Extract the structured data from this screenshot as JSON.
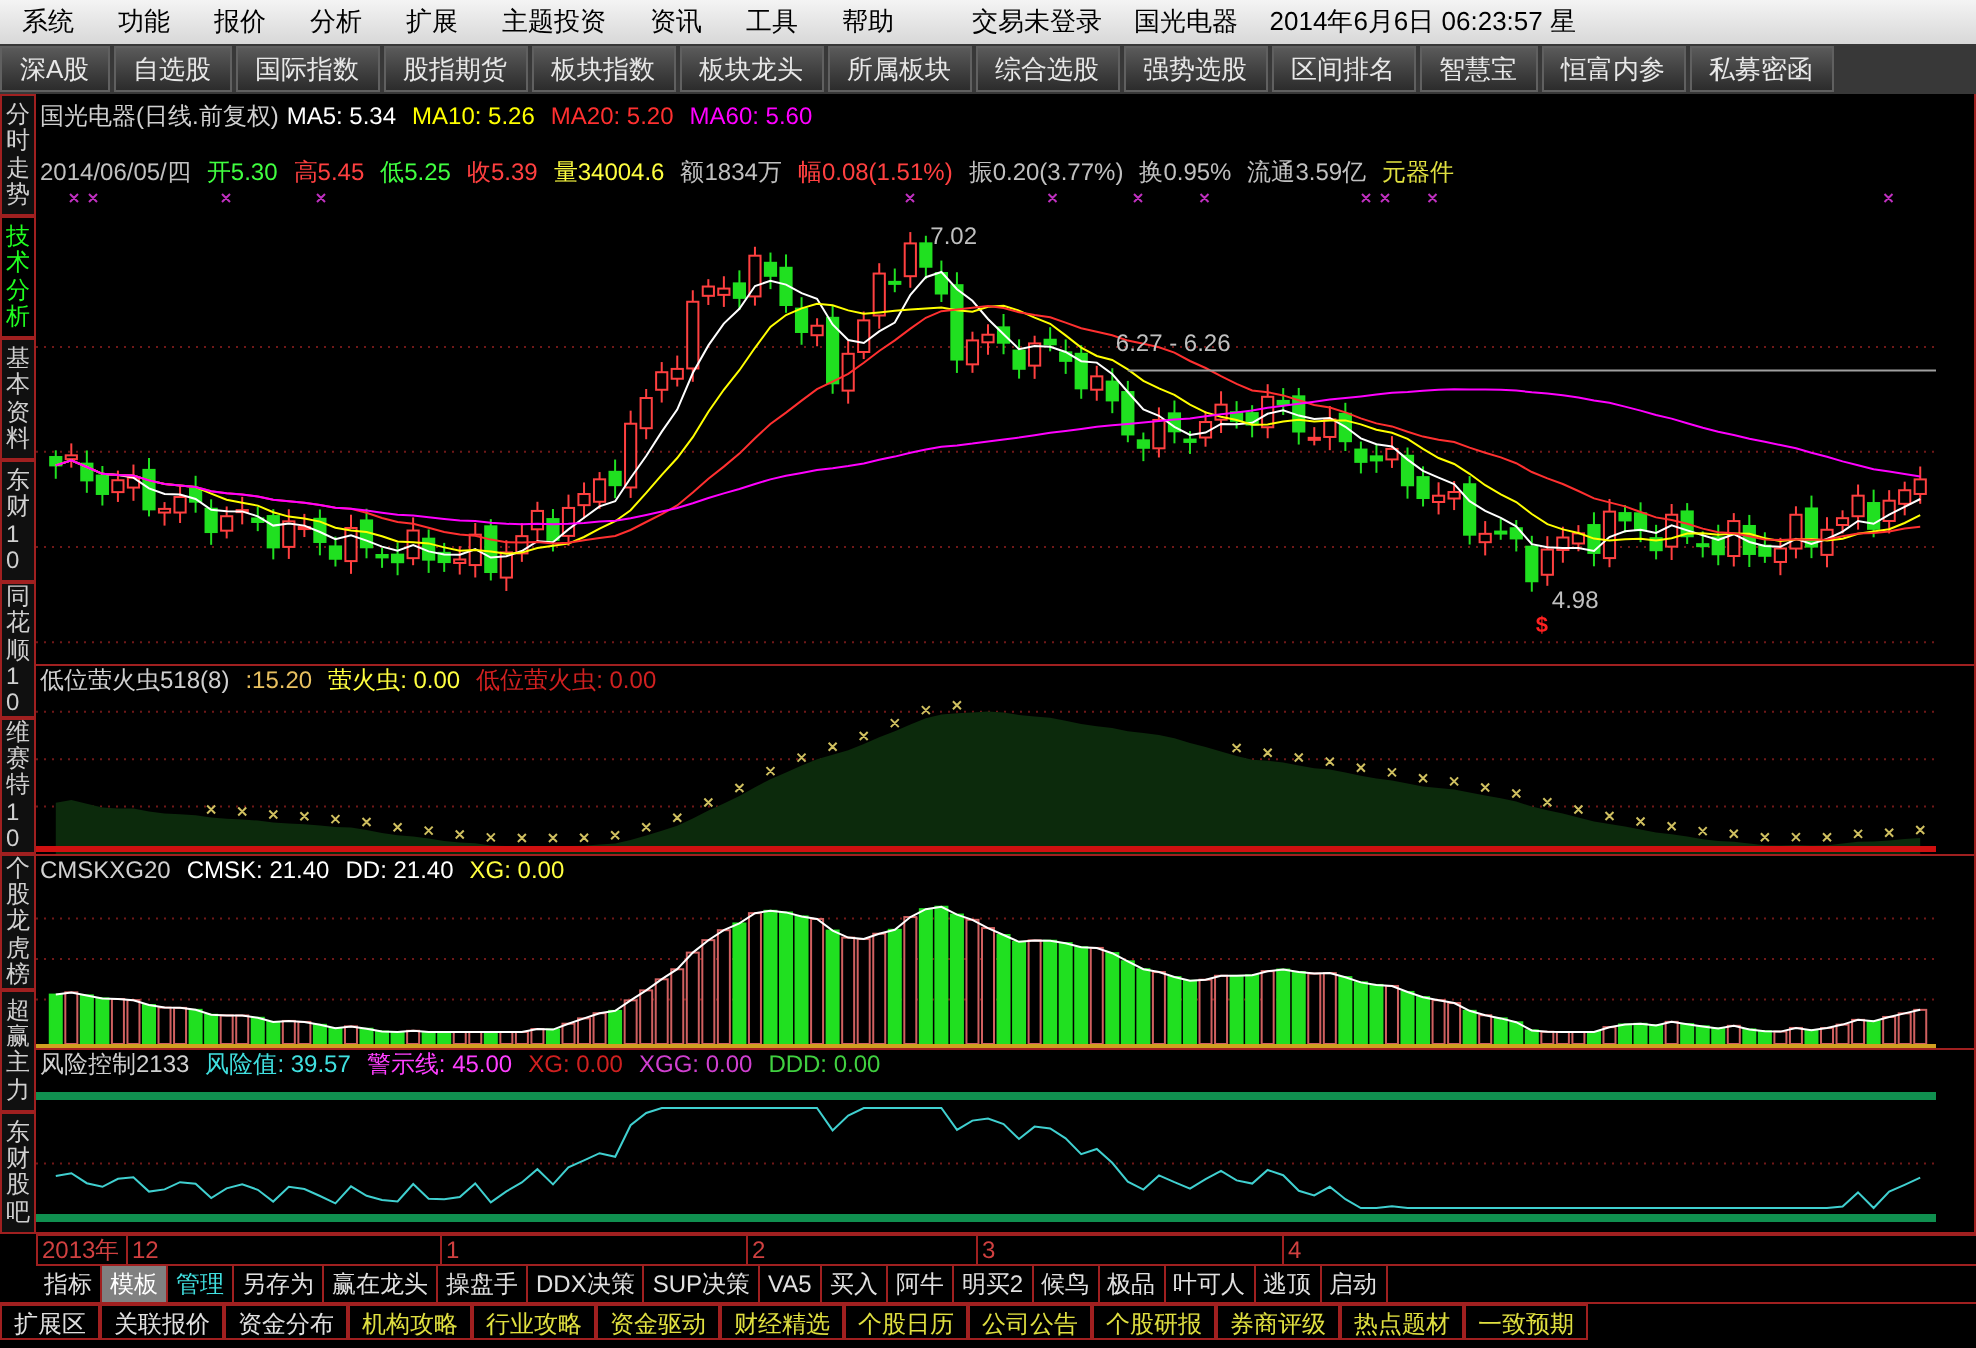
{
  "menu": [
    "系统",
    "功能",
    "报价",
    "分析",
    "扩展",
    "主题投资",
    "资讯",
    "工具",
    "帮助"
  ],
  "status": {
    "login": "交易未登录",
    "stock": "国光电器",
    "datetime": "2014年6月6日 06:23:57 星"
  },
  "toolbar": [
    {
      "label": "深A股",
      "selected": false
    },
    {
      "label": "自选股",
      "selected": false
    },
    {
      "label": "国际指数",
      "selected": false
    },
    {
      "label": "股指期货",
      "selected": false
    },
    {
      "label": "板块指数",
      "selected": false
    },
    {
      "label": "板块龙头",
      "selected": false
    },
    {
      "label": "所属板块",
      "selected": false
    },
    {
      "label": "综合选股",
      "selected": false
    },
    {
      "label": "强势选股",
      "selected": false
    },
    {
      "label": "区间排名",
      "selected": false
    },
    {
      "label": "智慧宝",
      "selected": false
    },
    {
      "label": "恒富内参",
      "selected": false
    },
    {
      "label": "私募密函",
      "selected": false
    }
  ],
  "sidebar": [
    {
      "label": "分时走势",
      "selected": false
    },
    {
      "label": "技术分析",
      "selected": true
    },
    {
      "label": "基本资料",
      "selected": false
    },
    {
      "label": "东财10",
      "selected": false
    },
    {
      "label": "同花顺10",
      "selected": false
    },
    {
      "label": "维赛特10",
      "selected": false
    },
    {
      "label": "个股龙虎榜",
      "selected": false
    },
    {
      "label": "超赢主力",
      "selected": false
    },
    {
      "label": "东财股吧",
      "selected": false
    }
  ],
  "main_chart": {
    "title": "国光电器(日线.前复权)",
    "indicators": [
      {
        "text": "MA5: 5.34",
        "color": "#ffffff"
      },
      {
        "text": "MA10: 5.26",
        "color": "#ffff00"
      },
      {
        "text": "MA20: 5.20",
        "color": "#ff3030"
      },
      {
        "text": "MA60: 5.60",
        "color": "#ff00ff"
      }
    ],
    "quote": [
      {
        "text": "2014/06/05/四",
        "color": "#c0c0c0"
      },
      {
        "text": "开5.30",
        "color": "#40ff40"
      },
      {
        "text": "高5.45",
        "color": "#ff4040"
      },
      {
        "text": "低5.25",
        "color": "#40ff40"
      },
      {
        "text": "收5.39",
        "color": "#ff4040"
      },
      {
        "text": "量34004.6",
        "color": "#ffff40"
      },
      {
        "text": "额1834万",
        "color": "#c0c0c0"
      },
      {
        "text": "幅0.08(1.51%)",
        "color": "#ff4040"
      },
      {
        "text": "振0.20(3.77%)",
        "color": "#c0c0c0"
      },
      {
        "text": "换0.95%",
        "color": "#c0c0c0"
      },
      {
        "text": "流通3.59亿",
        "color": "#c0c0c0"
      },
      {
        "text": "元器件",
        "color": "#e0e040"
      }
    ],
    "annotations": {
      "high": "7.02",
      "range": "6.27 - 6.26",
      "low": "4.98",
      "signal": "$"
    }
  },
  "panels": [
    {
      "kind": "firefly",
      "title": "低位萤火虫518(8)",
      "values": [
        {
          "text": ":15.20",
          "color": "#e8c060"
        },
        {
          "text": "萤火虫: 0.00",
          "color": "#ffff40"
        },
        {
          "text": "低位萤火虫: 0.00",
          "color": "#d02020"
        }
      ]
    },
    {
      "kind": "bars",
      "title": "CMSKXG20",
      "values": [
        {
          "text": "CMSK: 21.40",
          "color": "#ffffff"
        },
        {
          "text": "DD: 21.40",
          "color": "#ffffff"
        },
        {
          "text": "XG: 0.00",
          "color": "#ffff40"
        }
      ]
    },
    {
      "kind": "risk",
      "title": "风险控制2133",
      "values": [
        {
          "text": "风险值: 39.57",
          "color": "#40e0e0"
        },
        {
          "text": "警示线: 45.00",
          "color": "#ff40ff"
        },
        {
          "text": "XG: 0.00",
          "color": "#d02020"
        },
        {
          "text": "XGG: 0.00",
          "color": "#d040d0"
        },
        {
          "text": "DDD: 0.00",
          "color": "#40d040"
        }
      ]
    }
  ],
  "date_axis": [
    "2013年",
    "12",
    "1",
    "2",
    "3",
    "4"
  ],
  "tabs": [
    {
      "label": "指标",
      "selected": false,
      "kind": "plain"
    },
    {
      "label": "模板",
      "selected": true,
      "kind": "plain"
    },
    {
      "label": "管理",
      "selected": false,
      "kind": "accent"
    },
    {
      "label": "另存为",
      "selected": false,
      "kind": "plain"
    },
    {
      "label": "赢在龙头",
      "selected": false,
      "kind": "plain"
    },
    {
      "label": "操盘手",
      "selected": false,
      "kind": "plain"
    },
    {
      "label": "DDX决策",
      "selected": false,
      "kind": "plain"
    },
    {
      "label": "SUP决策",
      "selected": false,
      "kind": "plain"
    },
    {
      "label": "VA5",
      "selected": false,
      "kind": "plain"
    },
    {
      "label": "买入",
      "selected": false,
      "kind": "plain"
    },
    {
      "label": "阿牛",
      "selected": false,
      "kind": "plain"
    },
    {
      "label": "明买2",
      "selected": false,
      "kind": "plain"
    },
    {
      "label": "候鸟",
      "selected": false,
      "kind": "plain"
    },
    {
      "label": "极品",
      "selected": false,
      "kind": "plain"
    },
    {
      "label": "叶可人",
      "selected": false,
      "kind": "plain"
    },
    {
      "label": "逃顶",
      "selected": false,
      "kind": "plain"
    },
    {
      "label": "启动",
      "selected": false,
      "kind": "plain"
    }
  ],
  "bottom_tabs": [
    {
      "label": "扩展区",
      "kind": "plain"
    },
    {
      "label": "关联报价",
      "kind": "plain"
    },
    {
      "label": "资金分布",
      "kind": "plain"
    },
    {
      "label": "机构攻略",
      "kind": "info"
    },
    {
      "label": "行业攻略",
      "kind": "info"
    },
    {
      "label": "资金驱动",
      "kind": "info"
    },
    {
      "label": "财经精选",
      "kind": "info"
    },
    {
      "label": "个股日历",
      "kind": "info"
    },
    {
      "label": "公司公告",
      "kind": "info"
    },
    {
      "label": "个股研报",
      "kind": "info"
    },
    {
      "label": "券商评级",
      "kind": "info"
    },
    {
      "label": "热点题材",
      "kind": "info"
    },
    {
      "label": "一致预期",
      "kind": "info"
    }
  ]
}
